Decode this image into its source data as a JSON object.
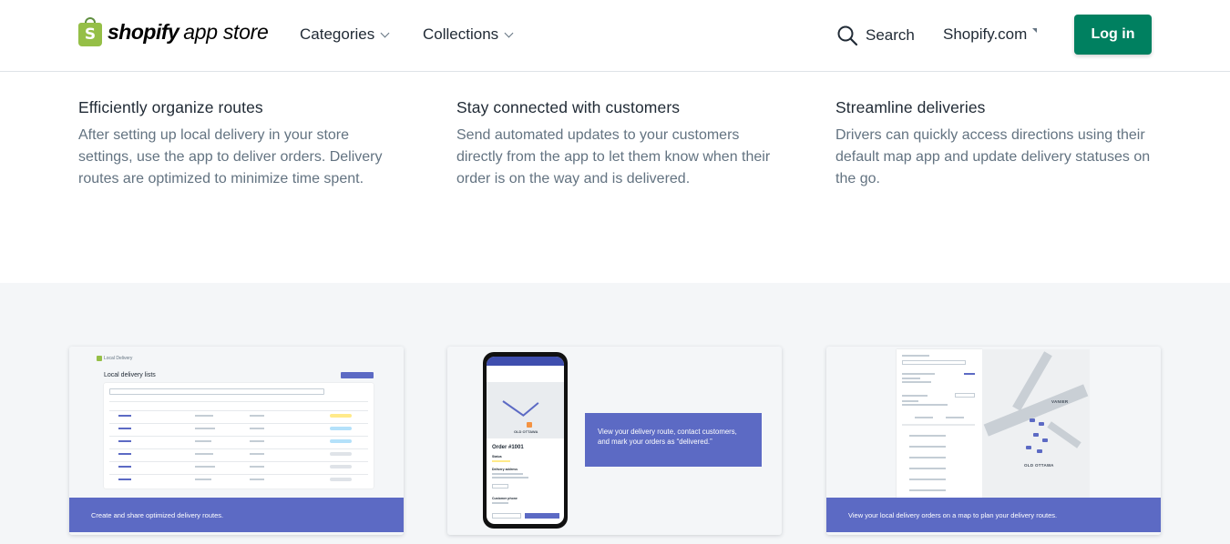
{
  "header": {
    "logo_bold": "shopify",
    "logo_light": "app store",
    "nav": [
      {
        "label": "Categories"
      },
      {
        "label": "Collections"
      }
    ],
    "search_label": "Search",
    "shopify_link": "Shopify.com",
    "login_label": "Log in"
  },
  "features": [
    {
      "title": "Efficiently organize routes",
      "text": "After setting up local delivery in your store settings, use the app to deliver orders. Delivery routes are optimized to minimize time spent."
    },
    {
      "title": "Stay connected with customers",
      "text": "Send automated updates to your customers directly from the app to let them know when their order is on the way and is delivered."
    },
    {
      "title": "Streamline deliveries",
      "text": "Drivers can quickly access directions using their default map app and update delivery statuses on the go."
    }
  ],
  "screenshots": {
    "card1": {
      "app_name": "Local Delivery",
      "heading": "Local delivery lists",
      "caption": "Create and share optimized delivery routes."
    },
    "card2": {
      "order": "Order #1001",
      "status_label": "Status",
      "address_label": "Delivery address",
      "phone_label": "Customer phone",
      "map_label": "OLD OTTAWA",
      "callout": "View your delivery route, contact customers, and mark your orders as “delivered.”"
    },
    "card3": {
      "map_labels": [
        "VANIER",
        "OLD OTTAWA"
      ],
      "caption": "View your local delivery orders on a map to plan your delivery routes."
    }
  },
  "colors": {
    "login_bg": "#008060",
    "accent_indigo": "#5c6ac4",
    "logo_green": "#95bf47",
    "body_text": "#637381",
    "heading_text": "#212b36",
    "section_gray": "#f4f6f8"
  }
}
